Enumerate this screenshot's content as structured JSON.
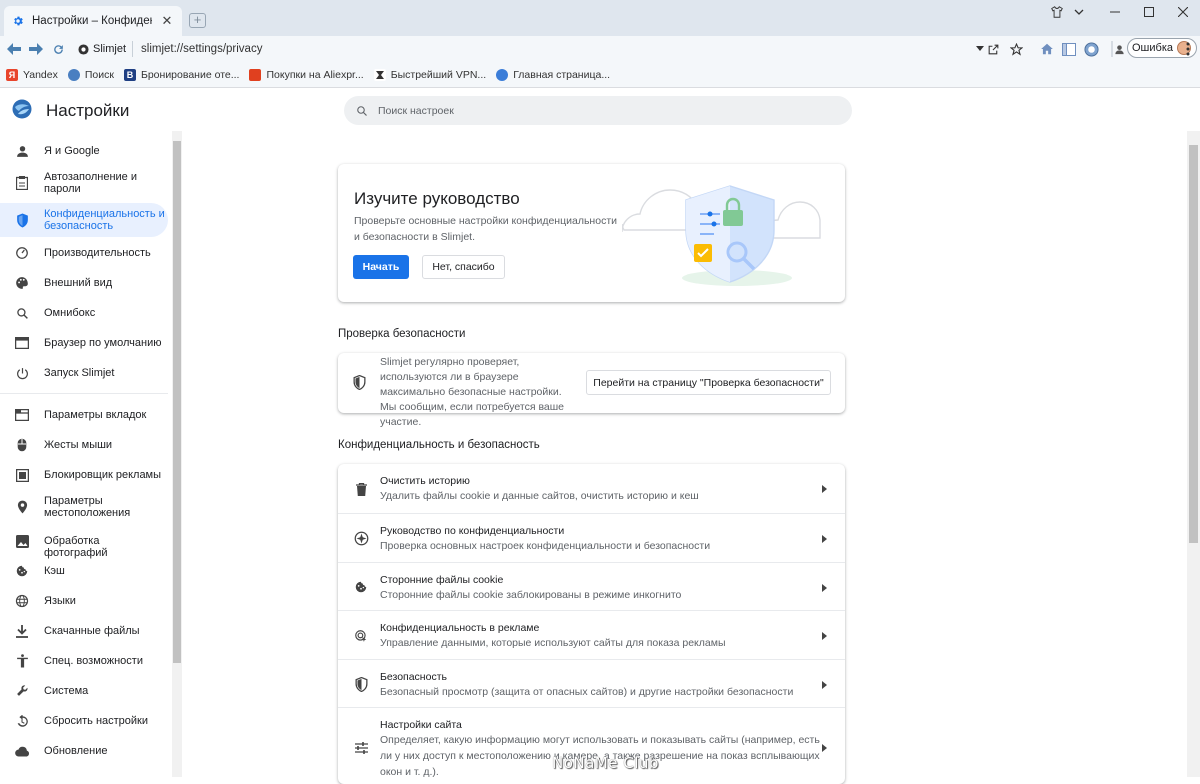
{
  "window": {
    "tab_title": "Настройки – Конфиденциальн",
    "url_chip": "Slimjet",
    "url": "slimjet://settings/privacy",
    "profile_label": "Ошибка"
  },
  "bookmarks": [
    {
      "label": "Yandex",
      "color": "#e8452c",
      "glyph": "Я"
    },
    {
      "label": "Поиск",
      "color": "#4a7fc1",
      "glyph": ""
    },
    {
      "label": "Бронирование оте...",
      "color": "#1f3f83",
      "glyph": "B"
    },
    {
      "label": "Покупки на Aliexpr...",
      "color": "#e0401f",
      "glyph": ""
    },
    {
      "label": "Быстрейший VPN...",
      "color": "#333333",
      "glyph": ""
    },
    {
      "label": "Главная страница...",
      "color": "#3b7dd8",
      "glyph": ""
    }
  ],
  "page": {
    "title": "Настройки",
    "search_placeholder": "Поиск настроек"
  },
  "sidebar": {
    "items": [
      {
        "label": "Я и Google",
        "icon": "person-icon"
      },
      {
        "label": "Автозаполнение и пароли",
        "icon": "clipboard-icon"
      },
      {
        "label": "Конфиденциальность и безопасность",
        "icon": "shield-icon",
        "active": true
      },
      {
        "label": "Производительность",
        "icon": "speedometer-icon"
      },
      {
        "label": "Внешний вид",
        "icon": "palette-icon"
      },
      {
        "label": "Омнибокс",
        "icon": "search-icon"
      },
      {
        "label": "Браузер по умолчанию",
        "icon": "browser-icon"
      },
      {
        "label": "Запуск Slimjet",
        "icon": "power-icon"
      },
      {
        "label": "Параметры вкладок",
        "icon": "tabs-icon"
      },
      {
        "label": "Жесты мыши",
        "icon": "mouse-icon"
      },
      {
        "label": "Блокировщик рекламы",
        "icon": "block-icon"
      },
      {
        "label": "Параметры местоположения",
        "icon": "location-icon"
      },
      {
        "label": "Обработка фотографий",
        "icon": "image-icon"
      },
      {
        "label": "Кэш",
        "icon": "cookie-icon"
      },
      {
        "label": "Языки",
        "icon": "globe-icon"
      },
      {
        "label": "Скачанные файлы",
        "icon": "download-icon"
      },
      {
        "label": "Спец. возможности",
        "icon": "accessibility-icon"
      },
      {
        "label": "Система",
        "icon": "wrench-icon"
      },
      {
        "label": "Сбросить настройки",
        "icon": "reset-icon"
      },
      {
        "label": "Обновление",
        "icon": "cloud-icon"
      }
    ]
  },
  "guide": {
    "title": "Изучите руководство",
    "description": "Проверьте основные настройки конфиденциальности и безопасности в Slimjet.",
    "start_label": "Начать",
    "dismiss_label": "Нет, спасибо"
  },
  "safety_check": {
    "section_title": "Проверка безопасности",
    "description": "Slimjet регулярно проверяет, используются ли в браузере максимально безопасные настройки. Мы сообщим, если потребуется ваше участие.",
    "button_label": "Перейти на страницу \"Проверка безопасности\""
  },
  "privacy": {
    "section_title": "Конфиденциальность и безопасность",
    "rows": [
      {
        "title": "Очистить историю",
        "subtitle": "Удалить файлы cookie и данные сайтов, очистить историю и кеш",
        "icon": "trash-icon"
      },
      {
        "title": "Руководство по конфиденциальности",
        "subtitle": "Проверка основных настроек конфиденциальности и безопасности",
        "icon": "compass-icon"
      },
      {
        "title": "Сторонние файлы cookie",
        "subtitle": "Сторонние файлы cookie заблокированы в режиме инкогнито",
        "icon": "cookie-icon"
      },
      {
        "title": "Конфиденциальность в рекламе",
        "subtitle": "Управление данными, которые используют сайты для показа рекламы",
        "icon": "ads-icon"
      },
      {
        "title": "Безопасность",
        "subtitle": "Безопасный просмотр (защита от опасных сайтов) и другие настройки безопасности",
        "icon": "shield-icon"
      },
      {
        "title": "Настройки сайта",
        "subtitle": "Определяет, какую информацию могут использовать и показывать сайты (например, есть ли у них доступ к местоположению и камере, а также разрешение на показ всплывающих окон и т. д.).",
        "icon": "sliders-icon"
      }
    ]
  },
  "watermark": "NoNaMe Club",
  "colors": {
    "accent": "#1a73e8",
    "active_bg": "#e8f0fe",
    "chrome": "#dfe6ee"
  }
}
